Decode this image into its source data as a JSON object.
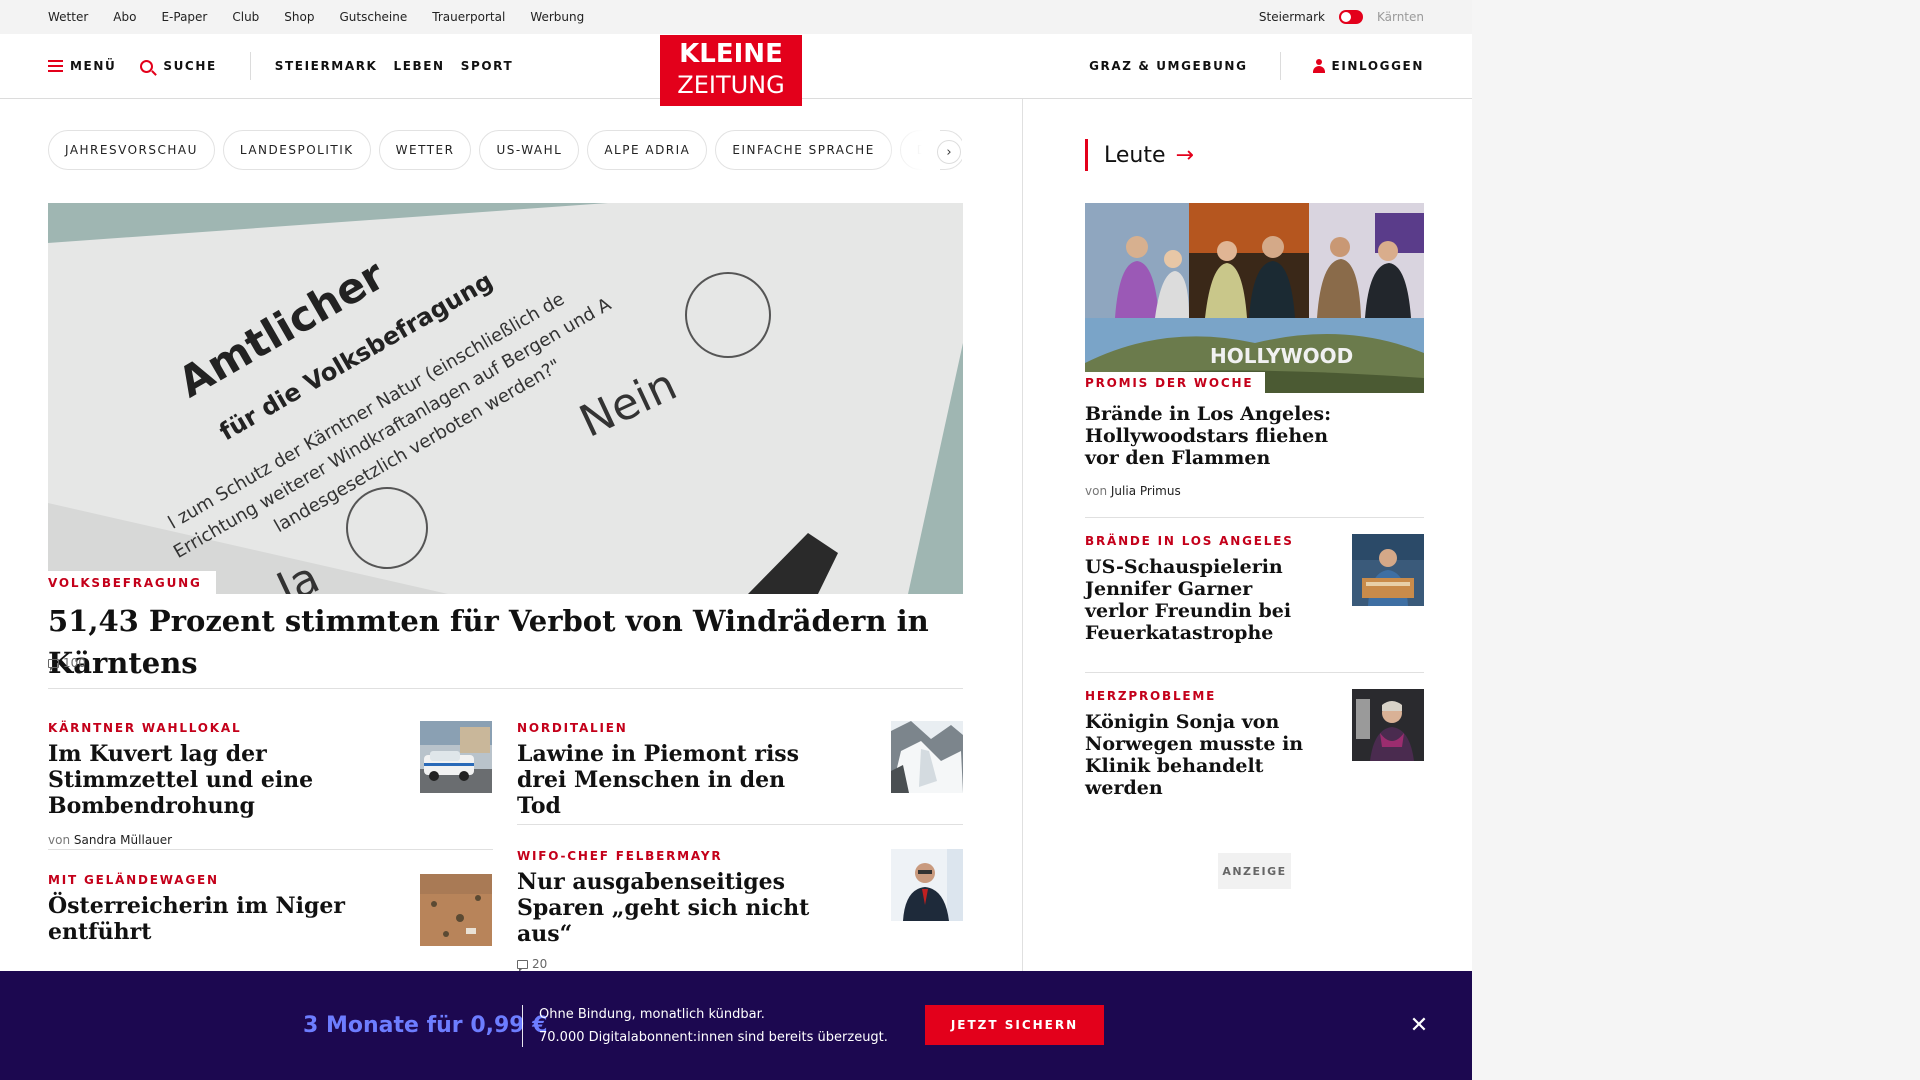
{
  "topbar": {
    "links": [
      "Wetter",
      "Abo",
      "E-Paper",
      "Club",
      "Shop",
      "Gutscheine",
      "Trauerportal",
      "Werbung"
    ],
    "region_active": "Steiermark",
    "region_inactive": "Kärnten"
  },
  "header": {
    "menu_label": "MENÜ",
    "search_label": "SUCHE",
    "nav": [
      "STEIERMARK",
      "LEBEN",
      "SPORT"
    ],
    "logo_line1": "KLEINE",
    "logo_line2": "ZEITUNG",
    "region_link": "GRAZ & UMGEBUNG",
    "login_label": "EINLOGGEN"
  },
  "topics": [
    "JAHRESVORSCHAU",
    "LANDESPOLITIK",
    "WETTER",
    "US-WAHL",
    "ALPE ADRIA",
    "EINFACHE SPRACHE",
    "DOS"
  ],
  "hero": {
    "kicker": "VOLKSBEFRAGUNG",
    "title": "51,43 Prozent stimmten für Verbot von Windrädern in Kärntens",
    "comments": "100",
    "image": {
      "line1": "Amtlicher",
      "line2": "für die Volksbefragung",
      "line3": "l zum Schutz der Kärntner Natur (einschließlich de",
      "line4": "Errichtung weiterer Windkraftanlagen auf Bergen und A",
      "line5": "landesgesetzlich verboten werden?\"",
      "nein": "Nein",
      "ja": "Ja"
    }
  },
  "teasers": [
    {
      "kicker": "KÄRNTNER WAHLLOKAL",
      "title": "Im Kuvert lag der Stimmzettel und eine Bombendrohung",
      "byline_prefix": "von",
      "author": "Sandra Müllauer"
    },
    {
      "kicker": "NORDITALIEN",
      "title": "Lawine in Piemont riss drei Menschen in den Tod"
    },
    {
      "kicker": "MIT GELÄNDEWAGEN",
      "title": "Österreicherin im Niger entführt"
    },
    {
      "kicker": "WIFO-CHEF FELBERMAYR",
      "title": "Nur ausgabenseitiges Sparen „geht sich nicht aus“",
      "comments": "20"
    }
  ],
  "sidebar": {
    "section_title": "Leute",
    "lead": {
      "kicker": "PROMIS DER WOCHE",
      "title": "Brände in Los Angeles: Hollywoodstars fliehen vor den Flammen",
      "byline_prefix": "von",
      "author": "Julia Primus",
      "image_sign": "HOLLYWOOD"
    },
    "items": [
      {
        "kicker": "BRÄNDE IN LOS ANGELES",
        "title": "US-Schauspielerin Jennifer Garner verlor Freundin bei Feuerkatastrophe"
      },
      {
        "kicker": "HERZPROBLEME",
        "title": "Königin Sonja von Norwegen musste in Klinik behandelt werden"
      }
    ],
    "ad_label": "ANZEIGE"
  },
  "banner": {
    "price": "3 Monate für 0,99 €",
    "line1": "Ohne Bindung, monatlich kündbar.",
    "line2": "70.000 Digitalabonnent:innen sind bereits überzeugt.",
    "cta": "JETZT SICHERN"
  },
  "colors": {
    "brand_red": "#e3001b",
    "kicker_red": "#c4001a",
    "banner_bg": "#1c0850",
    "banner_price": "#6d7dff"
  }
}
